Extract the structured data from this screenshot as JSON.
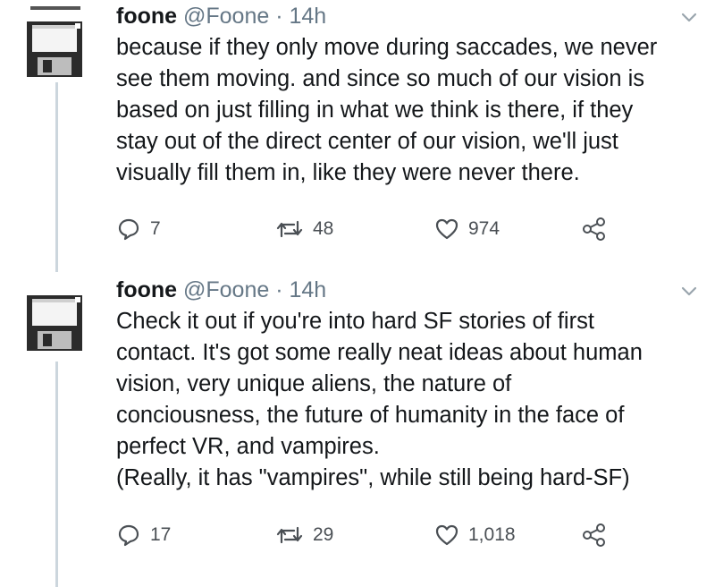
{
  "tweets": [
    {
      "display_name": "foone",
      "handle": "@Foone",
      "separator": "·",
      "time": "14h",
      "lines": [
        "because if they only move during saccades, we never",
        "see them moving. and since so much of our vision is",
        "based on just filling in what we think is there, if they",
        "stay out of the direct center of our vision, we'll just",
        "visually fill them in, like they were never there."
      ],
      "replies": "7",
      "retweets": "48",
      "likes": "974"
    },
    {
      "display_name": "foone",
      "handle": "@Foone",
      "separator": "·",
      "time": "14h",
      "lines": [
        "Check it out if you're into hard SF stories of first",
        "contact. It's got some really neat ideas about human",
        "vision, very unique aliens, the nature of",
        "conciousness, the future of humanity in the face of",
        "perfect VR, and vampires.",
        "(Really, it has \"vampires\", while still being hard-SF)"
      ],
      "replies": "17",
      "retweets": "29",
      "likes": "1,018"
    }
  ],
  "icons": {
    "avatar": "floppy-disk-icon",
    "reply": "reply-icon",
    "retweet": "retweet-icon",
    "like": "heart-icon",
    "share": "share-icon",
    "menu": "chevron-down-icon"
  },
  "colors": {
    "text": "#14171a",
    "secondary": "#657786",
    "thread_line": "#ccd6dd"
  }
}
